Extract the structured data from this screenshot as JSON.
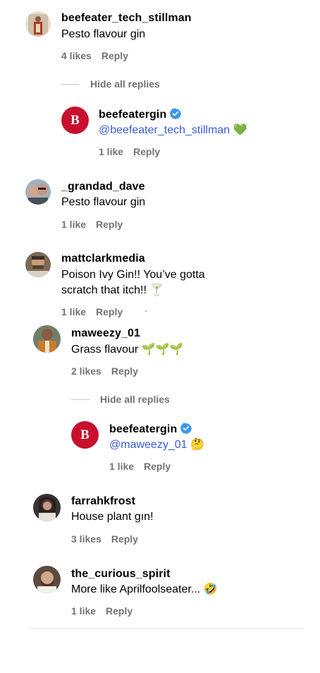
{
  "comments": {
    "c1": {
      "username": "beefeater_tech_stillman",
      "text": "Pesto flavour gin",
      "likes": "4 likes",
      "reply": "Reply",
      "hide_replies": "Hide all replies"
    },
    "r1": {
      "username": "beefeatergin",
      "mention": "@beefeater_tech_stillman",
      "emoji": "💚",
      "likes": "1 like",
      "reply": "Reply",
      "logo_letter": "B"
    },
    "c2": {
      "username": "_grandad_dave",
      "text": "Pesto flavour gin",
      "likes": "1 like",
      "reply": "Reply"
    },
    "c3": {
      "username": "mattclarkmedia",
      "text_line1": "Poison Ivy Gin!! You’ve gotta",
      "text_line2": "scratch that itch!! 🍸",
      "likes": "1 like",
      "reply": "Reply"
    },
    "c4": {
      "username": "maweezy_01",
      "text": "Grass flavour 🌱🌱🌱",
      "likes": "2 likes",
      "reply": "Reply",
      "hide_replies": "Hide all replies"
    },
    "r2": {
      "username": "beefeatergin",
      "mention": "@maweezy_01",
      "emoji": "🤔",
      "likes": "1 like",
      "reply": "Reply",
      "logo_letter": "B"
    },
    "c5": {
      "username": "farrahkfrost",
      "text": "House plant gın!",
      "likes": "3 likes",
      "reply": "Reply"
    },
    "c6": {
      "username": "the_curious_spirit",
      "text": "More like Aprilfoolseater... 🤣",
      "likes": "1 like",
      "reply": "Reply"
    }
  },
  "colors": {
    "mention": "#3b5bd6",
    "brand": "#c8102e",
    "verified": "#3897f0",
    "meta": "#737373"
  }
}
